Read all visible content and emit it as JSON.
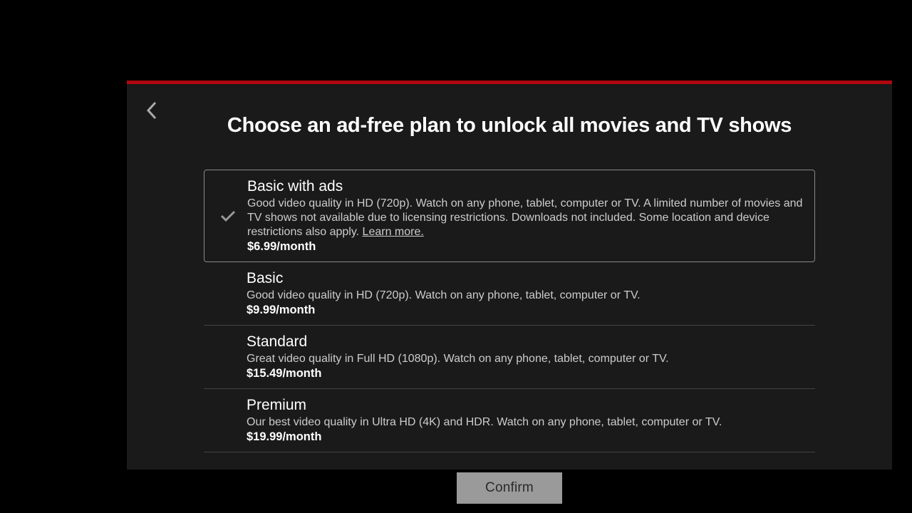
{
  "title": "Choose an ad-free plan to unlock all movies and TV shows",
  "plans": [
    {
      "name": "Basic with ads",
      "desc_pre": "Good video quality in HD (720p). Watch on any phone, tablet, computer or TV. A limited number of movies and TV shows not available due to licensing restrictions. Downloads not included. Some location and device restrictions also apply. ",
      "learn_more": "Learn more.",
      "price": "$6.99/month",
      "selected": true
    },
    {
      "name": "Basic",
      "desc": "Good video quality in HD (720p). Watch on any phone, tablet, computer or TV.",
      "price": "$9.99/month"
    },
    {
      "name": "Standard",
      "desc": "Great video quality in Full HD (1080p). Watch on any phone, tablet, computer or TV.",
      "price": "$15.49/month"
    },
    {
      "name": "Premium",
      "desc": "Our best video quality in Ultra HD (4K) and HDR. Watch on any phone, tablet, computer or TV.",
      "price": "$19.99/month"
    }
  ],
  "confirm_label": "Confirm"
}
